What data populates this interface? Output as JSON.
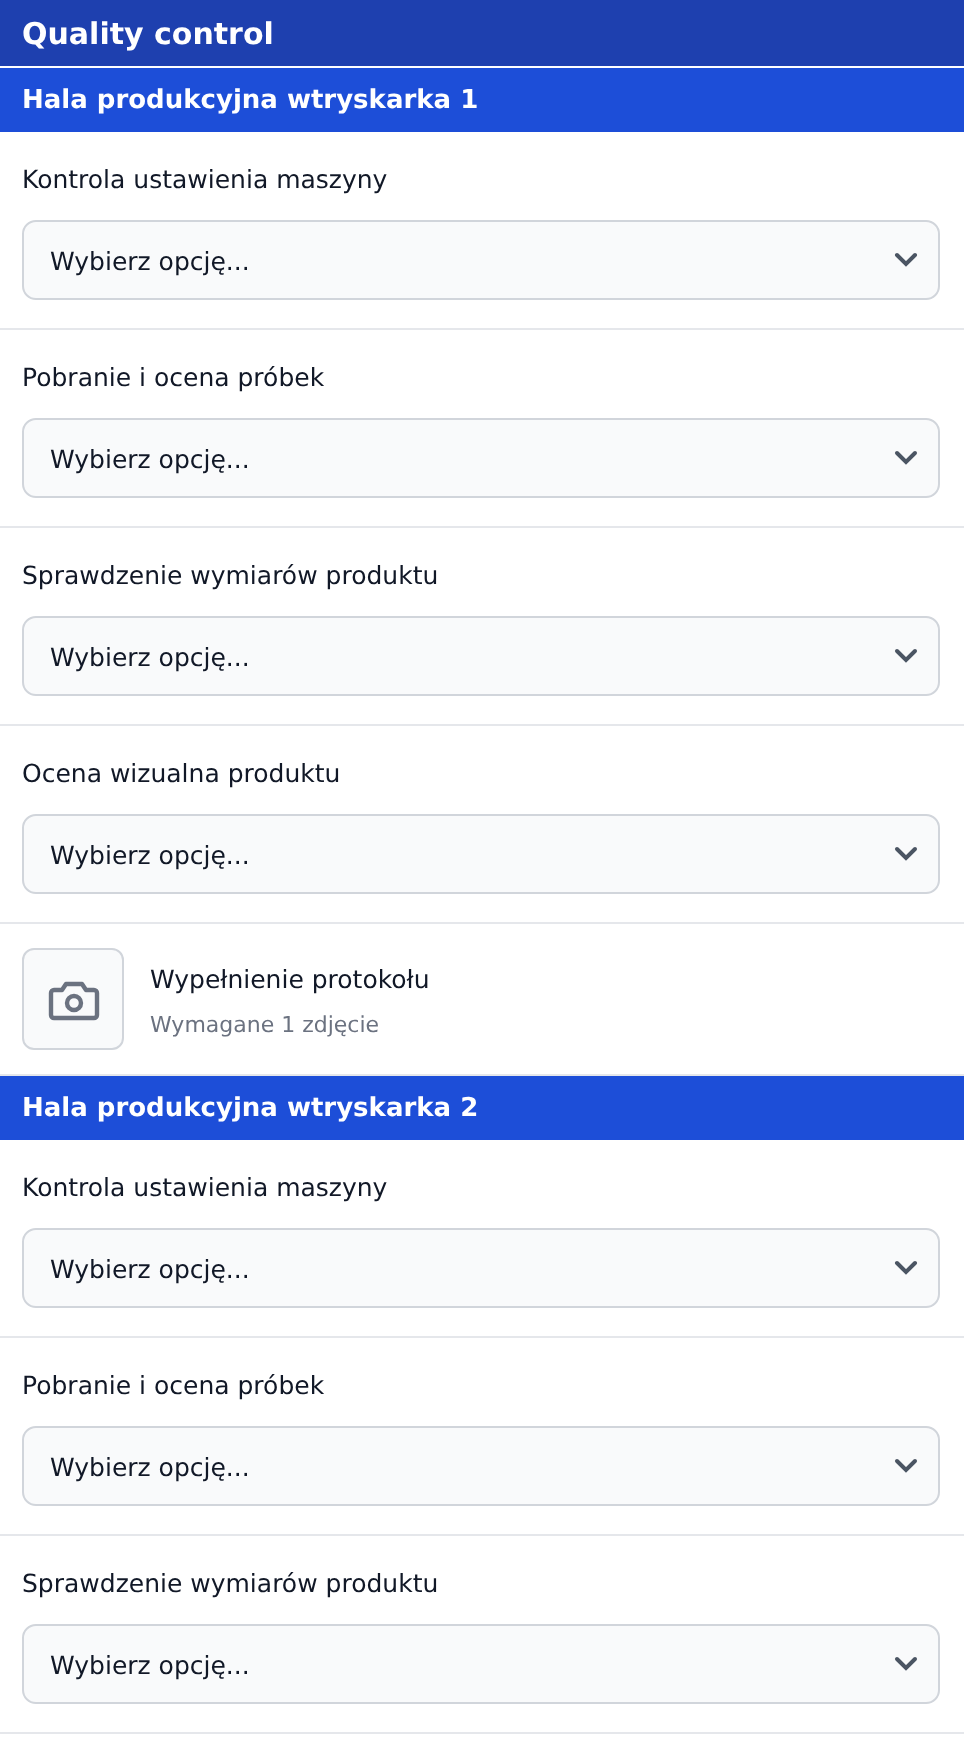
{
  "header": {
    "title": "Quality control"
  },
  "sections": [
    {
      "title": "Hala produkcyjna wtryskarka 1",
      "items": [
        {
          "kind": "select",
          "label": "Kontrola ustawienia maszyny",
          "placeholder": "Wybierz opcję..."
        },
        {
          "kind": "select",
          "label": "Pobranie i ocena próbek",
          "placeholder": "Wybierz opcję..."
        },
        {
          "kind": "select",
          "label": "Sprawdzenie wymiarów produktu",
          "placeholder": "Wybierz opcję..."
        },
        {
          "kind": "select",
          "label": "Ocena wizualna produktu",
          "placeholder": "Wybierz opcję..."
        },
        {
          "kind": "photo",
          "label": "Wypełnienie protokołu",
          "note": "Wymagane 1 zdjęcie"
        }
      ]
    },
    {
      "title": "Hala produkcyjna wtryskarka 2",
      "items": [
        {
          "kind": "select",
          "label": "Kontrola ustawienia maszyny",
          "placeholder": "Wybierz opcję..."
        },
        {
          "kind": "select",
          "label": "Pobranie i ocena próbek",
          "placeholder": "Wybierz opcję..."
        },
        {
          "kind": "select",
          "label": "Sprawdzenie wymiarów produktu",
          "placeholder": "Wybierz opcję..."
        }
      ]
    }
  ]
}
